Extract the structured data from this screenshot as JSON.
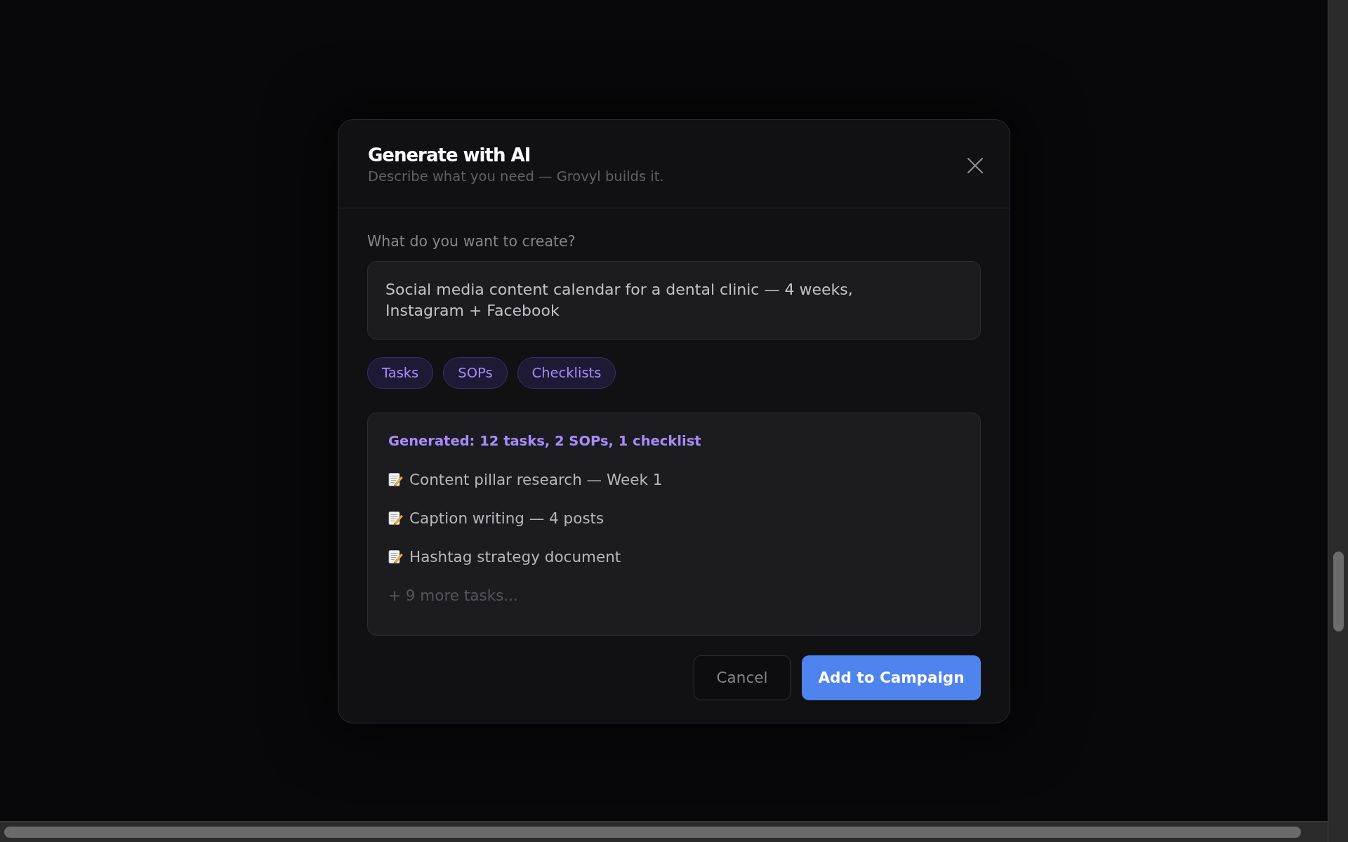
{
  "dialog": {
    "title": "Generate with AI",
    "subtitle": "Describe what you need — Grovyl builds it.",
    "prompt": {
      "label": "What do you want to create?",
      "value": "Social media content calendar for a dental clinic — 4 weeks, Instagram + Facebook"
    },
    "output_types": [
      {
        "label": "Tasks",
        "selected": true
      },
      {
        "label": "SOPs",
        "selected": true
      },
      {
        "label": "Checklists",
        "selected": true
      }
    ],
    "result": {
      "summary": "Generated: 12 tasks, 2 SOPs, 1 checklist",
      "items": [
        "Content pillar research — Week 1",
        "Caption writing — 4 posts",
        "Hashtag strategy document"
      ],
      "more": "+ 9 more tasks..."
    },
    "buttons": [
      {
        "label": "Cancel",
        "kind": "secondary"
      },
      {
        "label": "Add to Campaign",
        "kind": "primary"
      }
    ]
  }
}
